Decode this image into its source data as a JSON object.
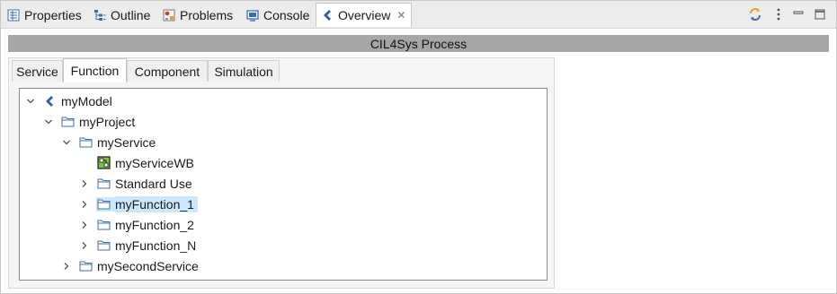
{
  "view_tabs": [
    {
      "label": "Properties",
      "icon": "properties-icon"
    },
    {
      "label": "Outline",
      "icon": "outline-icon"
    },
    {
      "label": "Problems",
      "icon": "problems-icon"
    },
    {
      "label": "Console",
      "icon": "console-icon"
    },
    {
      "label": "Overview",
      "icon": "overview-icon",
      "active": true
    }
  ],
  "toolbar": {
    "sync_icon": "sync-icon",
    "menu_icon": "view-menu-icon",
    "minimize_icon": "minimize-icon",
    "maximize_icon": "maximize-icon"
  },
  "process_title": "CIL4Sys Process",
  "inner_tabs": [
    {
      "label": "Service"
    },
    {
      "label": "Function",
      "active": true
    },
    {
      "label": "Component"
    },
    {
      "label": "Simulation"
    }
  ],
  "tree": [
    {
      "label": "myModel",
      "icon": "model-icon",
      "expanded": true
    },
    {
      "label": "myProject",
      "icon": "folder-icon",
      "expanded": true
    },
    {
      "label": "myService",
      "icon": "folder-icon",
      "expanded": true
    },
    {
      "label": "myServiceWB",
      "icon": "workbench-icon"
    },
    {
      "label": "Standard Use",
      "icon": "folder-icon",
      "expanded": false
    },
    {
      "label": "myFunction_1",
      "icon": "folder-icon",
      "expanded": false,
      "selected": true
    },
    {
      "label": "myFunction_2",
      "icon": "folder-icon",
      "expanded": false
    },
    {
      "label": "myFunction_N",
      "icon": "folder-icon",
      "expanded": false
    },
    {
      "label": "mySecondService",
      "icon": "folder-icon",
      "expanded": false
    }
  ],
  "colors": {
    "selection": "#cce8ff",
    "title_bar": "#a6a6a6",
    "model_icon": "#2d5fa8",
    "workbench_icon": "#7cc242"
  }
}
